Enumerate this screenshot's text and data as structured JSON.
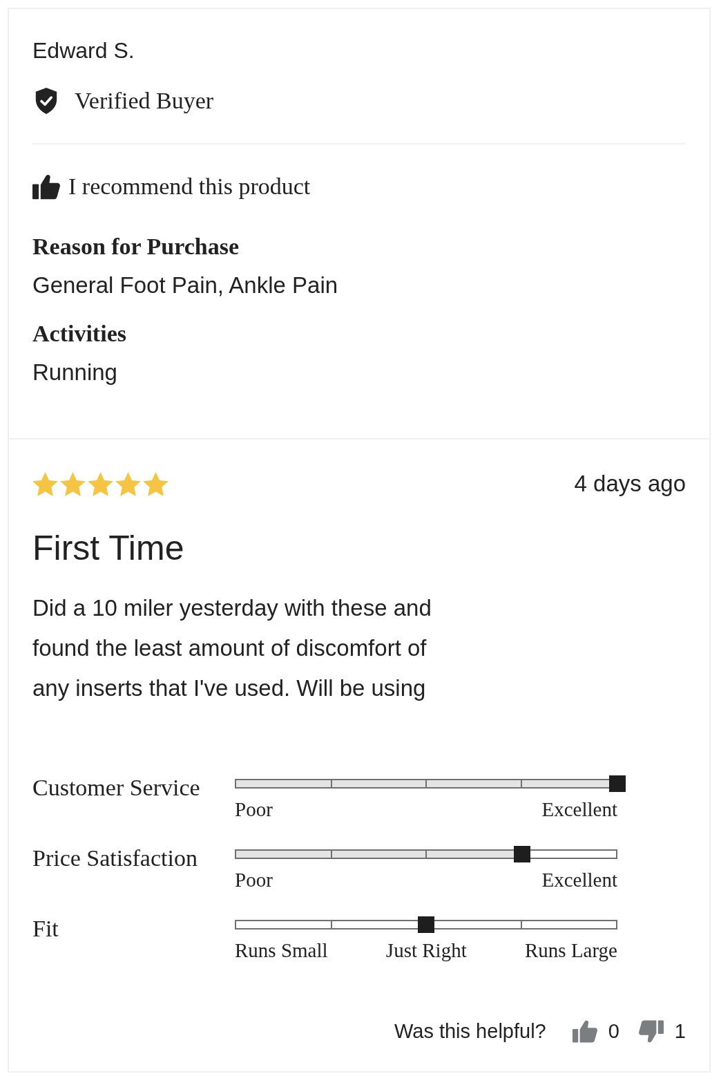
{
  "reviewer": {
    "name": "Edward S.",
    "badge": "Verified Buyer",
    "verified": true
  },
  "recommendation": {
    "text": "I recommend this product",
    "recommended": true
  },
  "details": [
    {
      "label": "Reason for Purchase",
      "value": "General Foot Pain, Ankle Pain"
    },
    {
      "label": "Activities",
      "value": "Running"
    }
  ],
  "review": {
    "stars": 5,
    "date": "4 days ago",
    "title": "First Time",
    "body": "Did a 10 miler yesterday with these and found the least amount of discomfort of any inserts that I've used. Will be using"
  },
  "sliders": [
    {
      "kind": "rating",
      "label": "Customer Service",
      "level": 1,
      "scale_labels": [
        "Poor",
        "Excellent"
      ]
    },
    {
      "kind": "rating",
      "label": "Price Satisfaction",
      "level": 0.75,
      "scale_labels": [
        "Poor",
        "Excellent"
      ]
    },
    {
      "kind": "fit",
      "label": "Fit",
      "level": 0.5,
      "scale_labels": [
        "Runs Small",
        "Just Right",
        "Runs Large"
      ]
    }
  ],
  "helpful": {
    "question": "Was this helpful?",
    "yes_count": "0",
    "no_count": "1"
  }
}
